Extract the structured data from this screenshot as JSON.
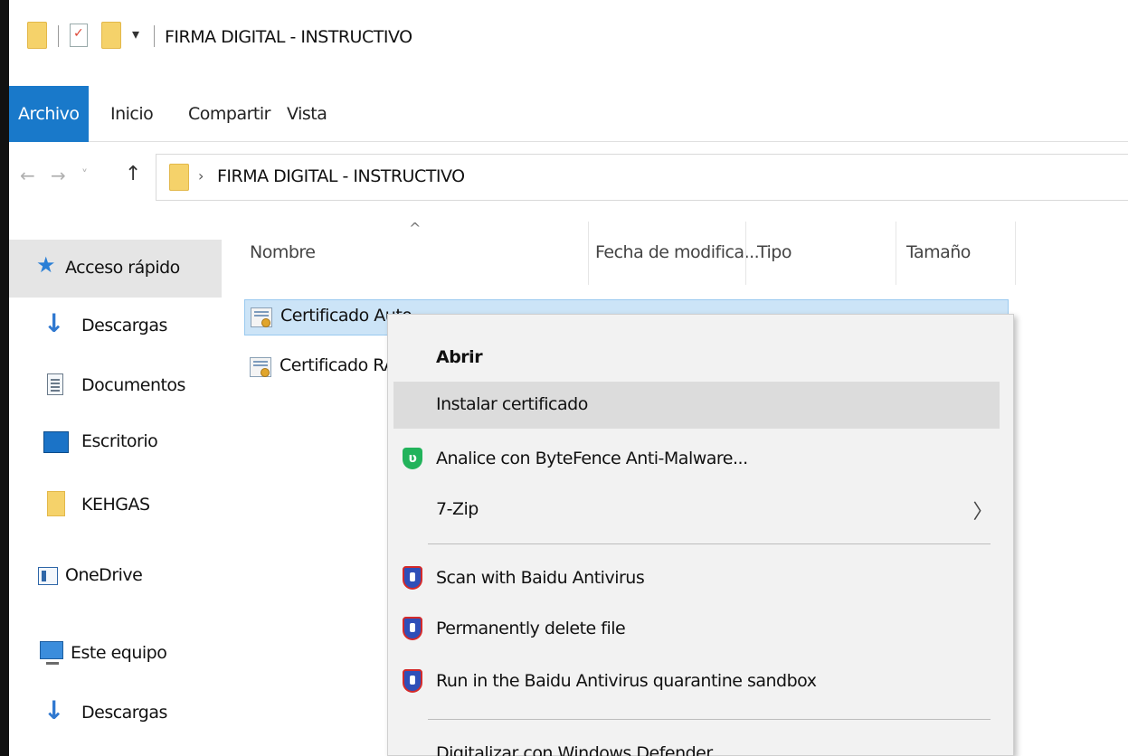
{
  "window": {
    "title": "FIRMA DIGITAL - INSTRUCTIVO",
    "quick_access_dropdown": "▾"
  },
  "ribbon": {
    "tabs": [
      {
        "label": "Archivo",
        "active": true
      },
      {
        "label": "Inicio",
        "active": false
      },
      {
        "label": "Compartir",
        "active": false
      },
      {
        "label": "Vista",
        "active": false
      }
    ]
  },
  "nav": {
    "back_icon": "←",
    "forward_icon": "→",
    "recent_icon": "˅",
    "up_icon": "↑",
    "chevron": "›",
    "breadcrumb": "FIRMA DIGITAL - INSTRUCTIVO"
  },
  "sidebar": {
    "items": [
      {
        "label": "Acceso rápido",
        "icon": "star-icon",
        "selected": true
      },
      {
        "label": "Descargas",
        "icon": "download-arrow-icon"
      },
      {
        "label": "Documentos",
        "icon": "document-icon"
      },
      {
        "label": "Escritorio",
        "icon": "desktop-icon"
      },
      {
        "label": "KEHGAS",
        "icon": "folder-icon"
      },
      {
        "label": "OneDrive",
        "icon": "onedrive-icon"
      },
      {
        "label": "Este equipo",
        "icon": "computer-icon"
      },
      {
        "label": "Descargas",
        "icon": "download-arrow-icon"
      }
    ]
  },
  "file_list": {
    "sort_indicator": "^",
    "columns": [
      "Nombre",
      "Fecha de modifica...",
      "Tipo",
      "Tamaño"
    ],
    "rows": [
      {
        "name": "Certificado Auto",
        "selected": true,
        "icon": "certificate-icon"
      },
      {
        "name": "Certificado RAIZ",
        "selected": false,
        "icon": "certificate-icon"
      }
    ]
  },
  "context_menu": {
    "items": [
      {
        "label": "Abrir",
        "bold": true
      },
      {
        "label": "Instalar certificado",
        "hover": true
      },
      {
        "label": "Analice con ByteFence Anti-Malware...",
        "icon": "bytefence-shield-icon"
      },
      {
        "label": "7-Zip",
        "submenu": true,
        "submenu_arrow": "〉"
      },
      {
        "label": "Scan with Baidu Antivirus",
        "icon": "baidu-shield-icon"
      },
      {
        "label": "Permanently delete file",
        "icon": "baidu-shield-icon"
      },
      {
        "label": "Run in the Baidu Antivirus quarantine sandbox",
        "icon": "baidu-shield-icon"
      },
      {
        "label": "Digitalizar con Windows Defender"
      }
    ]
  },
  "colors": {
    "accent": "#1979ca",
    "selection": "#cce4f7",
    "menu_bg": "#f2f2f2",
    "menu_hover": "#dcdcdc"
  }
}
